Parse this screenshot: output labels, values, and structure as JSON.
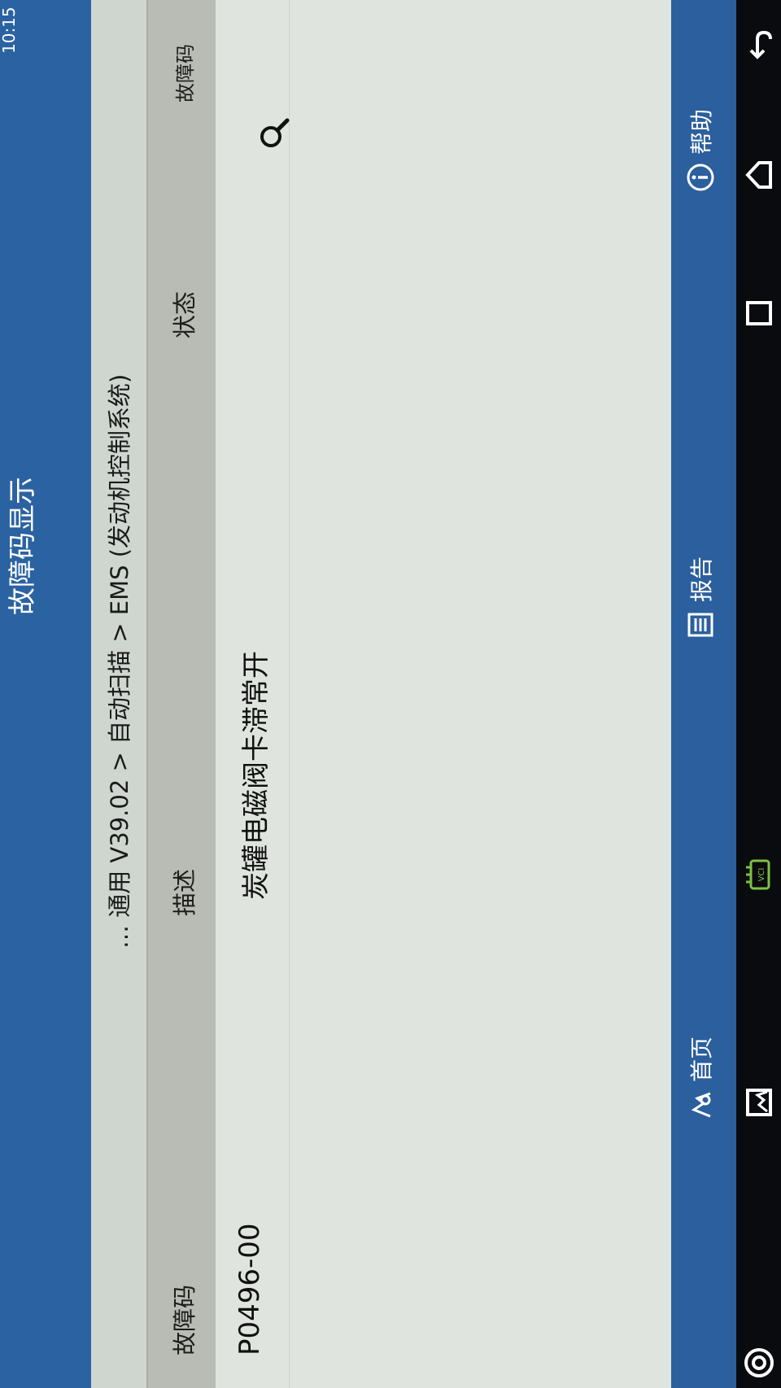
{
  "header": {
    "page_title": "故障码显示",
    "breadcrumb": "… 通用 V39.02 > 自动扫描 > EMS (发动机控制系统)"
  },
  "table": {
    "columns": [
      "故障码",
      "描述",
      "状态",
      "故障码"
    ],
    "rows": [
      {
        "code": "P0496-00",
        "description": "炭罐电磁阀卡滞常开",
        "status": ""
      }
    ]
  },
  "toolbar": {
    "home_label": "首页",
    "report_label": "报告",
    "help_label": "帮助"
  },
  "statusbar": {
    "time": "10:15"
  },
  "icons": [
    "search-icon",
    "home-icon",
    "report-icon",
    "help-icon",
    "back-icon",
    "nav-home-icon",
    "recents-icon",
    "vci-icon",
    "screenshot-icon",
    "browser-icon"
  ],
  "colors": {
    "titlebar": "#2b62a1",
    "toolbar": "#2b5f9e",
    "vci": "#7bc143"
  }
}
